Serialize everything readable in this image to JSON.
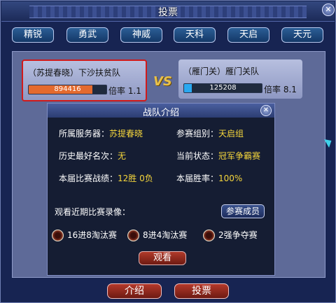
{
  "window": {
    "title": "投票",
    "close_icon": "close-icon"
  },
  "tabs": [
    "精锐",
    "勇武",
    "神威",
    "天科",
    "天启",
    "天元"
  ],
  "teams": [
    {
      "name": "（苏提春晓）下沙扶贫队",
      "score": "894416",
      "score_fraction": 0.82,
      "rate_label": "倍率",
      "rate": "1.1",
      "bar_color": "#e46a2e"
    },
    {
      "name": "（雁门关）雁门关队",
      "score": "125208",
      "score_fraction": 0.1,
      "rate_label": "倍率",
      "rate": "8.1",
      "bar_color": "#2aa8f0"
    }
  ],
  "vs": "VS",
  "popup": {
    "title": "战队介绍",
    "server_label": "所属服务器：",
    "server_value": "苏提春晓",
    "group_label": "参赛组别：",
    "group_value": "天启组",
    "best_label": "历史最好名次：",
    "best_value": "无",
    "status_label": "当前状态：",
    "status_value": "冠军争霸赛",
    "record_label": "本届比赛战绩：",
    "record_value": "12胜 0负",
    "winrate_label": "本届胜率：",
    "winrate_value": "100%",
    "replay_label": "观看近期比赛录像：",
    "members_button": "参赛成员",
    "replays": [
      "16进8淘汰赛",
      "8进4淘汰赛",
      "2强争夺赛"
    ],
    "watch_button": "观看"
  },
  "buttons": {
    "intro": "介绍",
    "vote": "投票"
  },
  "colors": {
    "accent_yellow": "#f5d63c",
    "selected_border": "#d11a1a"
  }
}
